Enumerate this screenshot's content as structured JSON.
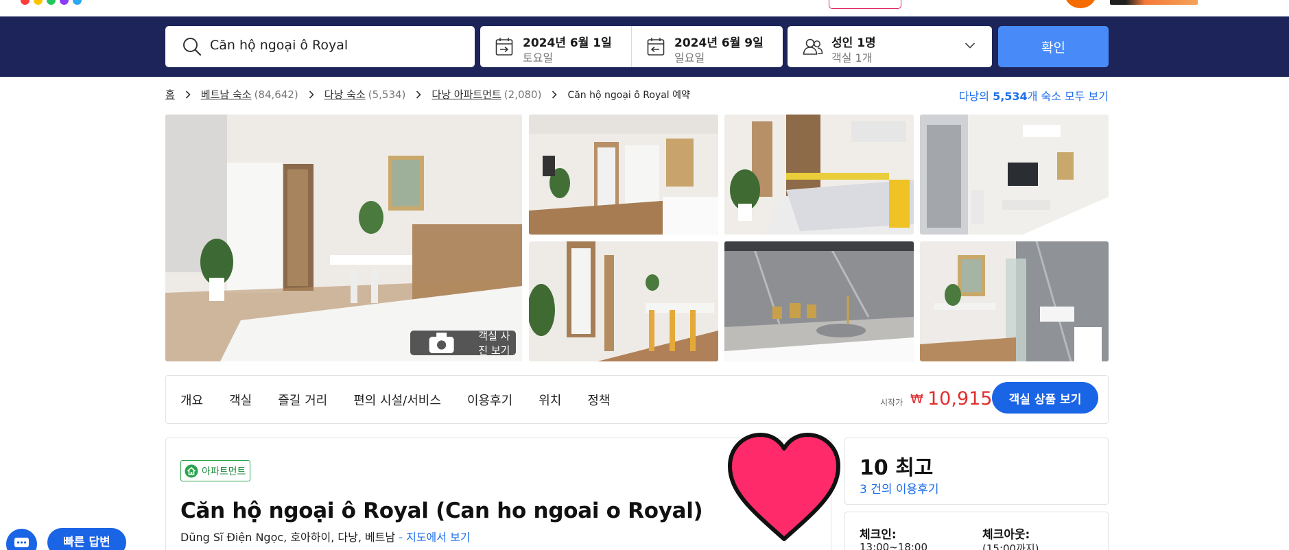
{
  "header": {
    "logo_dot_colors": [
      "#ff3b3b",
      "#ffc400",
      "#23c55e",
      "#8b3cf7",
      "#2aa8f2"
    ]
  },
  "search": {
    "query": "Căn hộ ngoại ô Royal",
    "checkin_date": "2024년 6월 1일",
    "checkin_day": "토요일",
    "checkout_date": "2024년 6월 9일",
    "checkout_day": "일요일",
    "guests": "성인 1명",
    "rooms": "객실 1개",
    "submit_label": "확인"
  },
  "breadcrumb": {
    "items": [
      {
        "label": "홈",
        "count": ""
      },
      {
        "label": "베트남 숙소",
        "count": "(84,642)"
      },
      {
        "label": "다낭 숙소",
        "count": "(5,534)"
      },
      {
        "label": "다낭 아파트먼트",
        "count": "(2,080)"
      }
    ],
    "current": "Căn hộ ngoại ô Royal 예약",
    "see_all_prefix": "다낭의 ",
    "see_all_count": "5,534",
    "see_all_suffix": "개 숙소 모두 보기"
  },
  "gallery": {
    "photo_button_label": "객실 사진 보기"
  },
  "tabs": {
    "items": [
      "개요",
      "객실",
      "즐길 거리",
      "편의 시설/서비스",
      "이용후기",
      "위치",
      "정책"
    ],
    "price_prefix": "시작가",
    "currency": "₩",
    "price": "10,915",
    "room_button_label": "객실 상품 보기"
  },
  "property": {
    "type_badge": "아파트먼트",
    "title": "Căn hộ ngoại ô Royal (Can ho ngoai o Royal)",
    "address": "Dũng Sĩ Điện Ngọc, 호아하이, 다낭, 베트남",
    "map_link": " - 지도에서 보기"
  },
  "rating": {
    "score": "10 최고",
    "reviews": "3 건의 이용후기"
  },
  "checkin": {
    "checkin_label": "체크인:",
    "checkin_time": "13:00~18:00",
    "checkout_label": "체크아웃:",
    "checkout_time": "(15:00까지)"
  },
  "floating": {
    "quick_reply_label": "빠른 답변"
  },
  "colors": {
    "search_bar_bg": "#1c2459",
    "primary_blue": "#1a64e6",
    "price_red": "#e12d2d",
    "heart_pink": "#ff2a6a"
  }
}
